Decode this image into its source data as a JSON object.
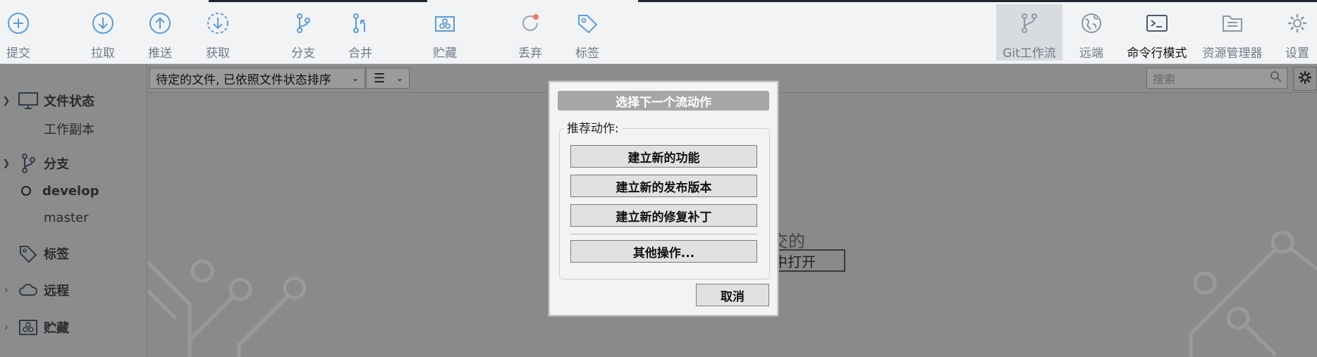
{
  "toolbar": {
    "commit": "提交",
    "pull": "拉取",
    "push": "推送",
    "fetch": "获取",
    "branch": "分支",
    "merge": "合并",
    "stash": "贮藏",
    "discard": "丢弃",
    "tag": "标签",
    "git_flow": "Git工作流",
    "remote": "远端",
    "terminal": "命令行模式",
    "explorer": "资源管理器",
    "settings": "设置"
  },
  "sidebar": {
    "file_status": "文件状态",
    "working_copy": "工作副本",
    "branches": "分支",
    "branch_develop": "develop",
    "branch_master": "master",
    "tags": "标签",
    "remotes": "远程",
    "stashes": "贮藏"
  },
  "main": {
    "sort_select": "待定的文件, 已依照文件状态排序",
    "search_placeholder": "搜索",
    "bg_text": "交的",
    "bg_button": "中打开"
  },
  "dialog": {
    "title": "选择下一个流动作",
    "group_label": "推荐动作:",
    "feature_btn": "建立新的功能",
    "release_btn": "建立新的发布版本",
    "hotfix_btn": "建立新的修复补丁",
    "other_btn": "其他操作...",
    "cancel_btn": "取消"
  },
  "colors": {
    "accent_blue": "#4a90d9",
    "discard_dot": "#f07860",
    "overlay_gray": "#8a8a8a"
  }
}
